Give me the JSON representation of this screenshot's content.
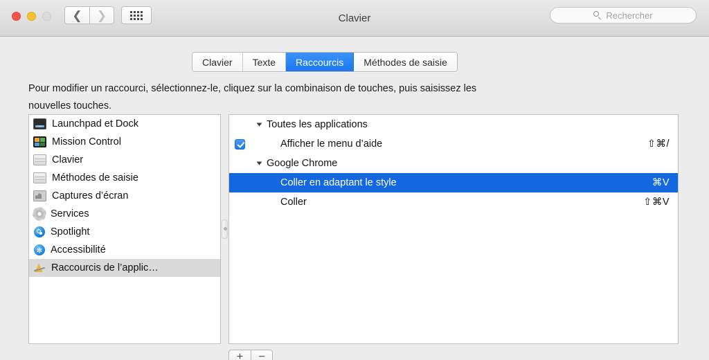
{
  "window": {
    "title": "Clavier",
    "traffic_lights": [
      "close",
      "minimize",
      "zoom"
    ]
  },
  "toolbar": {
    "back_icon": "chevron-left-icon",
    "forward_icon": "chevron-right-icon",
    "grid_icon": "grid-icon",
    "search_placeholder": "Rechercher",
    "search_value": ""
  },
  "tabs": [
    {
      "label": "Clavier",
      "selected": false
    },
    {
      "label": "Texte",
      "selected": false
    },
    {
      "label": "Raccourcis",
      "selected": true
    },
    {
      "label": "Méthodes de saisie",
      "selected": false
    }
  ],
  "description": "Pour modifier un raccourci, sélectionnez-le, cliquez sur la combinaison de touches, puis saisissez les nouvelles touches.",
  "sidebar": {
    "items": [
      {
        "label": "Launchpad et Dock",
        "icon": "launchpad-icon",
        "selected": false
      },
      {
        "label": "Mission Control",
        "icon": "mission-control-icon",
        "selected": false
      },
      {
        "label": "Clavier",
        "icon": "keyboard-icon",
        "selected": false
      },
      {
        "label": "Méthodes de saisie",
        "icon": "input-methods-icon",
        "selected": false
      },
      {
        "label": "Captures d’écran",
        "icon": "screenshot-icon",
        "selected": false
      },
      {
        "label": "Services",
        "icon": "gear-icon",
        "selected": false
      },
      {
        "label": "Spotlight",
        "icon": "spotlight-icon",
        "selected": false
      },
      {
        "label": "Accessibilité",
        "icon": "accessibility-icon",
        "selected": false
      },
      {
        "label": "Raccourcis de l’applic…",
        "icon": "app-shortcuts-icon",
        "selected": true
      }
    ]
  },
  "shortcut_list": [
    {
      "type": "group",
      "label": "Toutes les applications",
      "expanded": true
    },
    {
      "type": "item",
      "label": "Afficher le menu d’aide",
      "shortcut": "⇧⌘/",
      "checked": true,
      "selected": false
    },
    {
      "type": "group",
      "label": "Google Chrome",
      "expanded": true
    },
    {
      "type": "item",
      "label": "Coller en adaptant le style",
      "shortcut": "⌘V",
      "checked": false,
      "selected": true
    },
    {
      "type": "item",
      "label": "Coller",
      "shortcut": "⇧⌘V",
      "checked": false,
      "selected": false
    }
  ],
  "footer": {
    "add_label": "+",
    "remove_label": "−"
  },
  "colors": {
    "accent_selected": "#1367e0",
    "tab_selected": "#1a78ee",
    "checkbox": "#1a79ef",
    "window_bg": "#ececec",
    "panel_bg": "#ffffff"
  }
}
